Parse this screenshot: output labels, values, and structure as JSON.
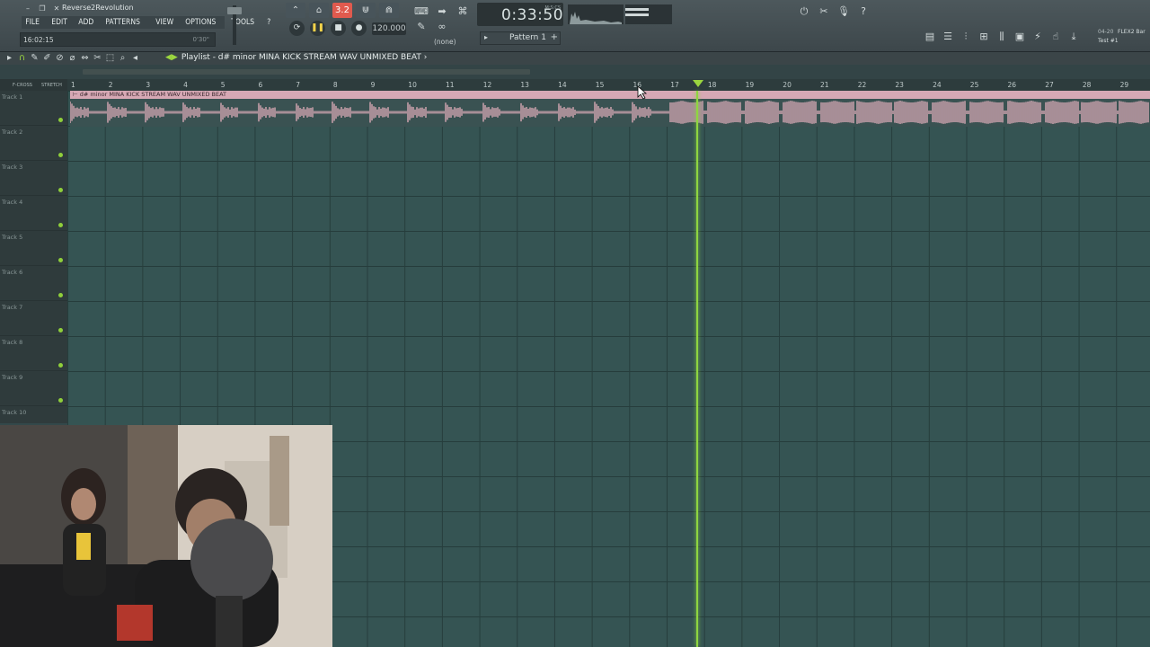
{
  "app": {
    "title": "Reverse2Revolution",
    "menus": [
      "FILE",
      "EDIT",
      "ADD",
      "PATTERNS",
      "VIEW",
      "OPTIONS",
      "TOOLS",
      "?"
    ],
    "hint_time": "16:02:15",
    "hint_value": "0'30\""
  },
  "transport": {
    "time": "0:33:50",
    "time_unit": "M:S:CS",
    "tempo": "120.000",
    "pattern": "Pattern 1",
    "pattern_mode": "3.2",
    "snap": "(none)"
  },
  "plugin": {
    "counter": "04-20",
    "name": "FLEX2 Bar",
    "preset": "Test #1"
  },
  "playlist": {
    "title": "Playlist - d# minor MINA KICK STREAM WAV UNMIXED BEAT",
    "arrow": "›",
    "header_left": [
      "F-CROSS",
      "STRETCH"
    ],
    "bars": [
      "1",
      "2",
      "3",
      "4",
      "5",
      "6",
      "7",
      "8",
      "9",
      "10",
      "11",
      "12",
      "13",
      "14",
      "15",
      "16",
      "17",
      "18",
      "19",
      "20",
      "21",
      "22",
      "23",
      "24",
      "25",
      "26",
      "27",
      "28",
      "29"
    ],
    "tracks": [
      "Track 1",
      "Track 2",
      "Track 3",
      "Track 4",
      "Track 5",
      "Track 6",
      "Track 7",
      "Track 8",
      "Track 9",
      "Track 10"
    ],
    "clip_name": "d# minor MINA KICK STREAM WAV UNMIXED BEAT",
    "playhead_bar": 17.7,
    "colors": {
      "clip": "#d6a8b4",
      "playhead": "#8fd640",
      "grid": "#355453"
    }
  },
  "icons": {
    "toolbar": [
      "pattern-song-icon",
      "metronome-icon",
      "record-mode-icon",
      "blend-icon",
      "wait-icon",
      "typing-keyboard-icon",
      "step-edit-icon",
      "loop-record-icon",
      "snap-icon",
      "link-icon"
    ],
    "right": [
      "undo-icon",
      "cut-icon",
      "mic-icon",
      "help-icon"
    ],
    "windows": [
      "playlist-window-icon",
      "channel-rack-icon",
      "mixer-icon",
      "piano-roll-icon",
      "browser-icon",
      "plugin-icon",
      "plug-icon",
      "touch-icon",
      "download-icon"
    ]
  }
}
